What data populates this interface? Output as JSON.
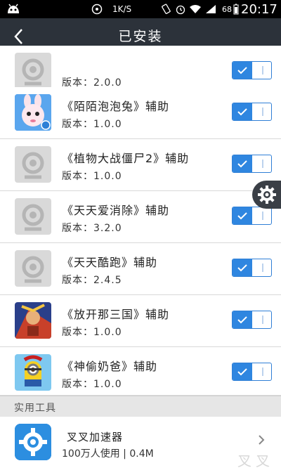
{
  "status_bar": {
    "speed": "1K/S",
    "battery": "68",
    "time": "20:17"
  },
  "header": {
    "title": "已安装"
  },
  "installed": [
    {
      "name": "",
      "version": "版本：2.0.0",
      "icon": "placeholder-icon",
      "enabled": true
    },
    {
      "name": "《陌陌泡泡兔》辅助",
      "version": "版本：1.0.0",
      "icon": "bunny-icon",
      "enabled": true
    },
    {
      "name": "《植物大战僵尸2》辅助",
      "version": "版本：1.0.0",
      "icon": "placeholder-icon",
      "enabled": true
    },
    {
      "name": "《天天爱消除》辅助",
      "version": "版本：3.2.0",
      "icon": "placeholder-icon",
      "enabled": true
    },
    {
      "name": "《天天酷跑》辅助",
      "version": "版本：2.4.5",
      "icon": "placeholder-icon",
      "enabled": true
    },
    {
      "name": "《放开那三国》辅助",
      "version": "版本：1.0.0",
      "icon": "warrior-icon",
      "enabled": true
    },
    {
      "name": "《神偷奶爸》辅助",
      "version": "版本：1.0.0",
      "icon": "minion-icon",
      "enabled": true
    }
  ],
  "section": {
    "title": "实用工具"
  },
  "tool": {
    "name": "叉叉加速器",
    "meta": "100万人使用 | 0.4M"
  },
  "watermark": "叉叉",
  "colors": {
    "header_bg": "#2c323a",
    "toggle_blue": "#2f86e0",
    "placeholder_gray": "#d9d9d9"
  }
}
